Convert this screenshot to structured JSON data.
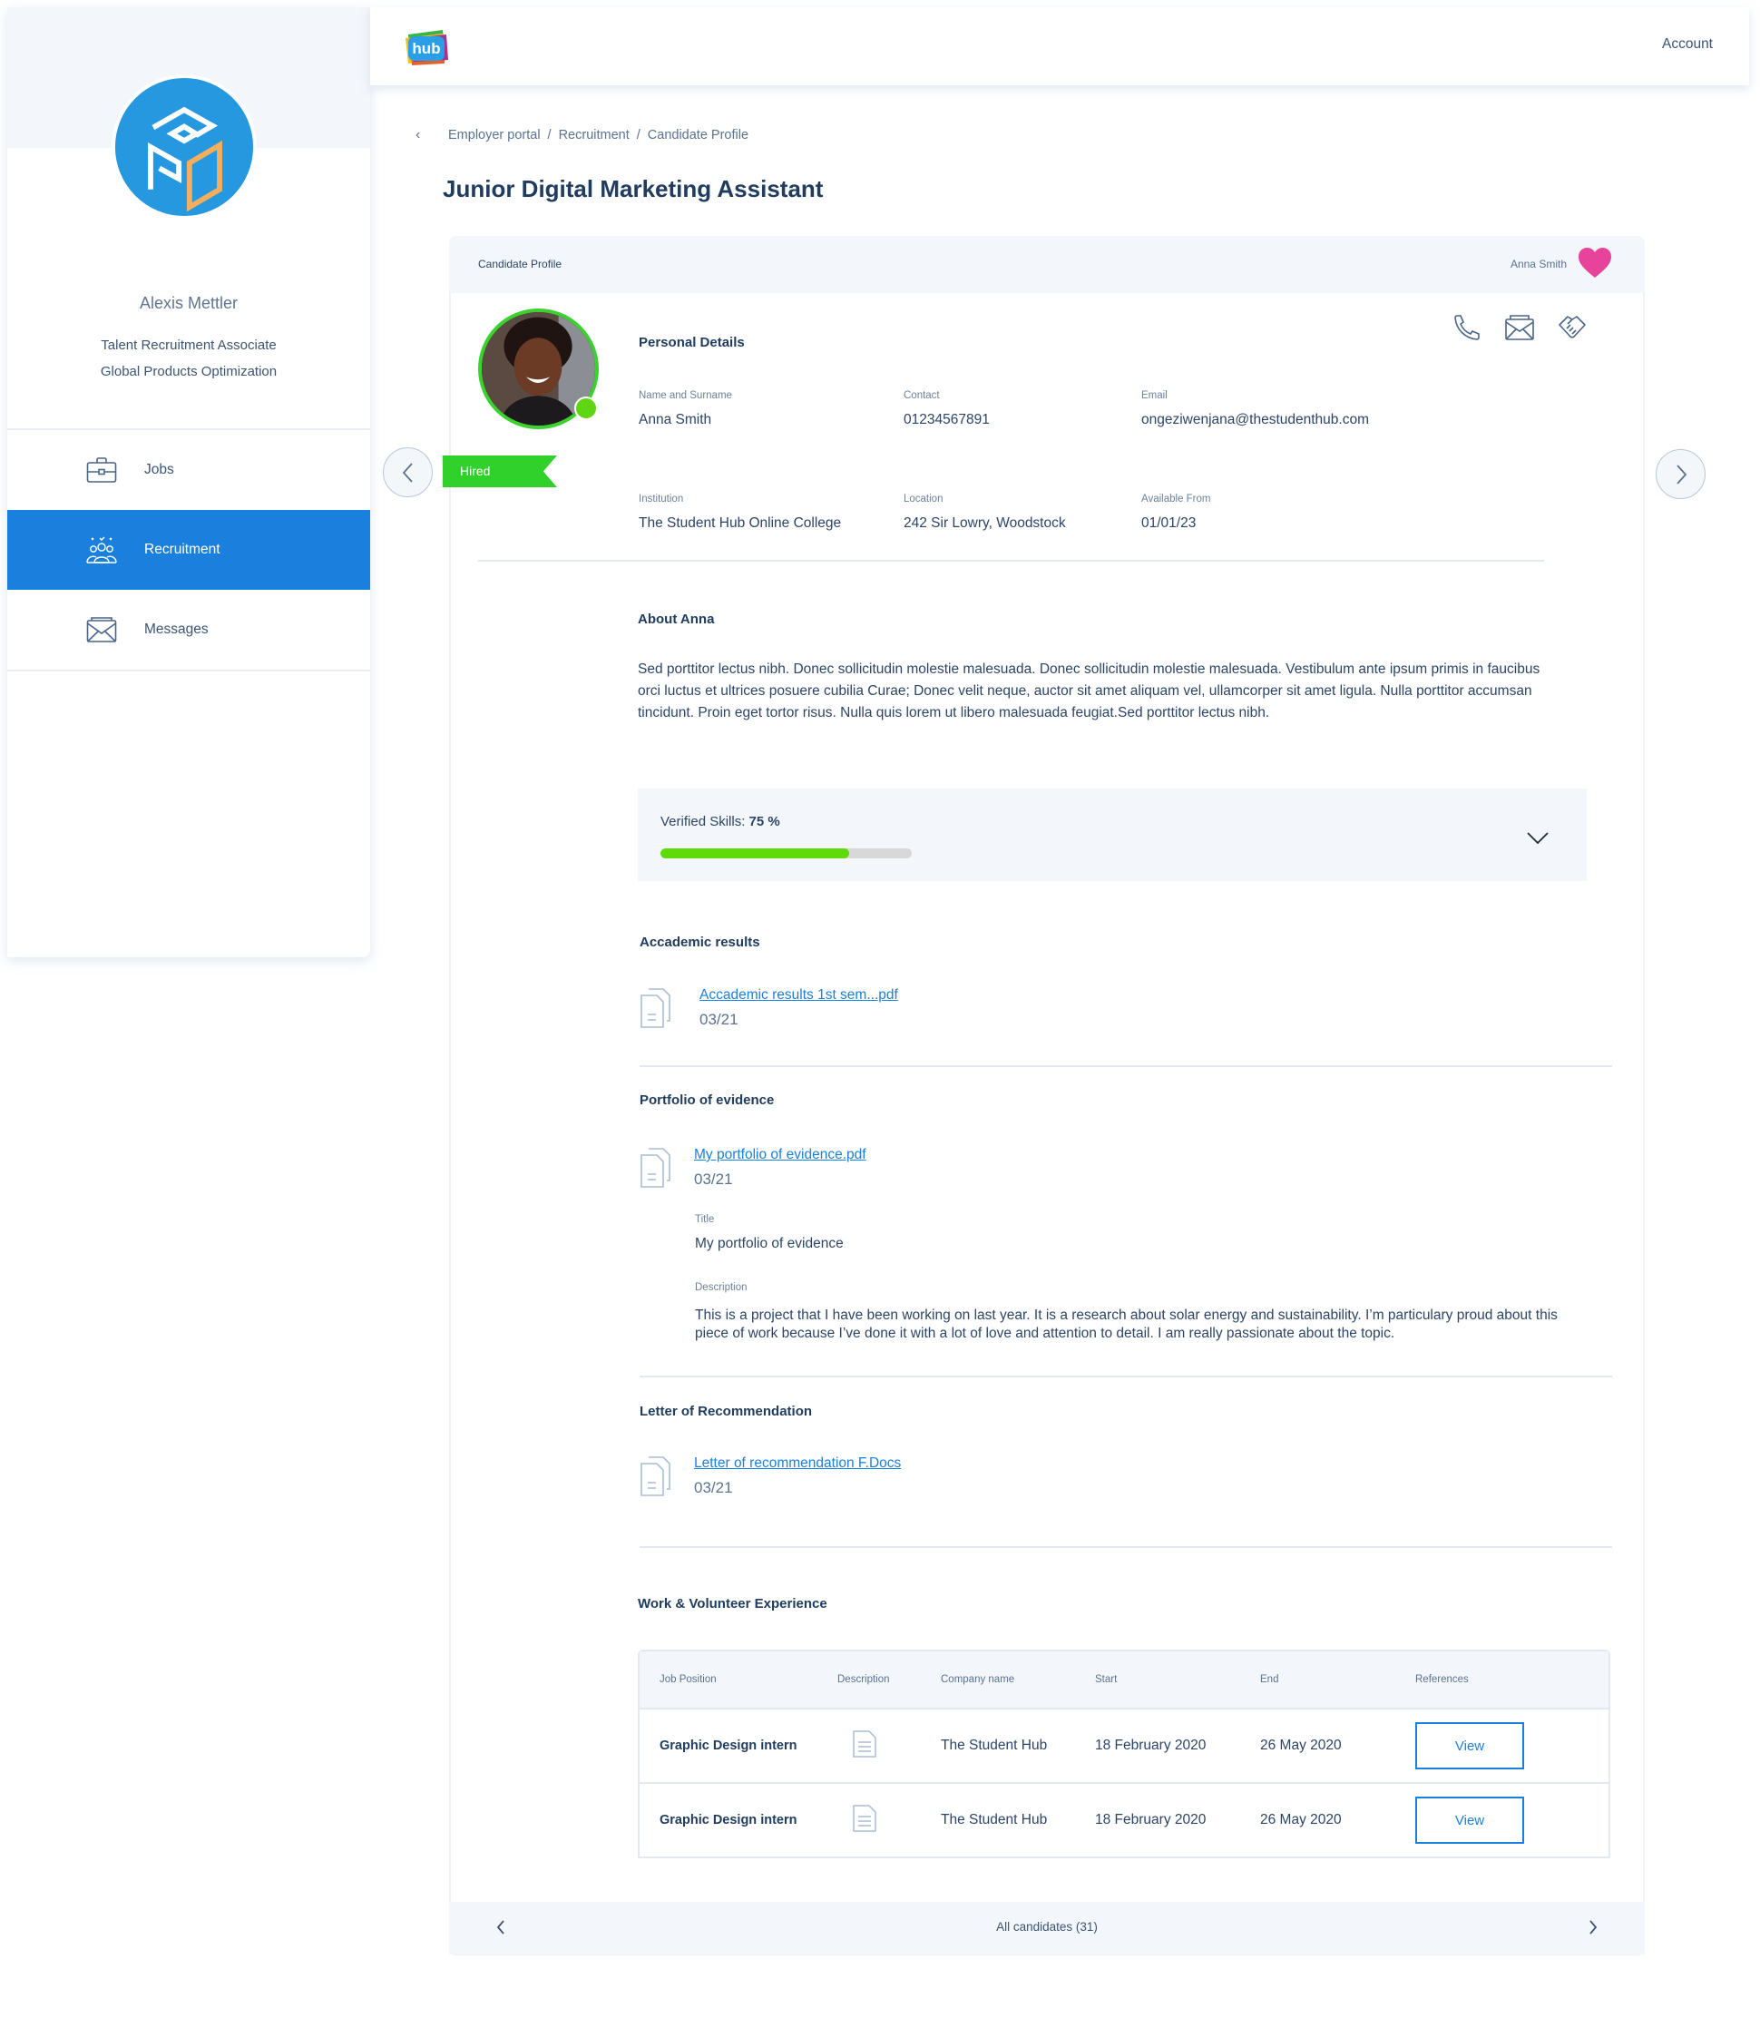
{
  "sidebar": {
    "user_name": "Alexis Mettler",
    "user_role": "Talent Recruitment Associate",
    "user_department": "Global Products Optimization",
    "org_logo_icon": "gpo-cube-logo",
    "items": [
      {
        "label": "Jobs",
        "icon": "briefcase-icon",
        "active": false
      },
      {
        "label": "Recruitment",
        "icon": "people-group-icon",
        "active": true
      },
      {
        "label": "Messages",
        "icon": "envelope-open-icon",
        "active": false
      }
    ]
  },
  "header": {
    "logo_text": "hub",
    "account_label": "Account"
  },
  "breadcrumb": {
    "items": [
      "Employer portal",
      "Recruitment",
      "Candidate Profile"
    ],
    "separator": "/"
  },
  "page_title": "Junior Digital Marketing Assistant",
  "card": {
    "header_label": "Candidate Profile",
    "candidate_name": "Anna Smith",
    "favorite": true,
    "status_badge": "Hired",
    "online": true
  },
  "personal_details": {
    "title": "Personal Details",
    "fields": [
      {
        "label": "Name and Surname",
        "value": "Anna Smith"
      },
      {
        "label": "Contact",
        "value": "01234567891"
      },
      {
        "label": "Email",
        "value": "ongeziwenjana@thestudenthub.com"
      },
      {
        "label": "Institution",
        "value": "The Student Hub Online College"
      },
      {
        "label": "Location",
        "value": "242 Sir Lowry, Woodstock"
      },
      {
        "label": "Available From",
        "value": "01/01/23"
      }
    ],
    "actions": [
      "phone-icon",
      "envelope-icon",
      "handshake-icon"
    ]
  },
  "about": {
    "title": "About Anna",
    "text": "Sed porttitor lectus nibh. Donec sollicitudin molestie malesuada. Donec sollicitudin molestie malesuada. Vestibulum ante ipsum primis in faucibus orci luctus et ultrices posuere cubilia Curae; Donec velit neque, auctor sit amet aliquam vel, ullamcorper sit amet ligula. Nulla porttitor accumsan tincidunt. Proin eget tortor risus. Nulla quis lorem ut libero malesuada feugiat.Sed porttitor lectus nibh."
  },
  "skills": {
    "label": "Verified Skills:",
    "value_text": "75 %",
    "percent": 75
  },
  "academic": {
    "title": "Accademic results",
    "file_name": "Accademic results 1st sem...pdf",
    "file_date": "03/21"
  },
  "portfolio": {
    "title": "Portfolio of evidence",
    "file_name": "My portfolio of evidence.pdf",
    "file_date": "03/21",
    "title_label": "Title",
    "title_value": "My portfolio of evidence",
    "description_label": "Description",
    "description_value": "This is a project that I have been working on last year. It is a research about solar energy and sustainability. I’m particulary proud about this piece of work because I’ve done it with a lot of love and attention to detail. I am really passionate about the topic."
  },
  "recommendation": {
    "title": "Letter of Recommendation",
    "file_name": "Letter of recommendation F.Docs",
    "file_date": "03/21"
  },
  "experience": {
    "title": "Work & Volunteer Experience",
    "columns": [
      "Job Position",
      "Description",
      "Company name",
      "Start",
      "End",
      "References"
    ],
    "rows": [
      {
        "position": "Graphic Design intern",
        "company": "The Student Hub",
        "start": "18 February 2020",
        "end": "26 May 2020",
        "action": "View"
      },
      {
        "position": "Graphic Design intern",
        "company": "The Student Hub",
        "start": "18 February 2020",
        "end": "26 May 2020",
        "action": "View"
      }
    ]
  },
  "footer": {
    "label": "All candidates (31)"
  },
  "colors": {
    "primary": "#1a7fdd",
    "success": "#2fd12a",
    "heart": "#e8439a",
    "text": "#2c4566"
  }
}
